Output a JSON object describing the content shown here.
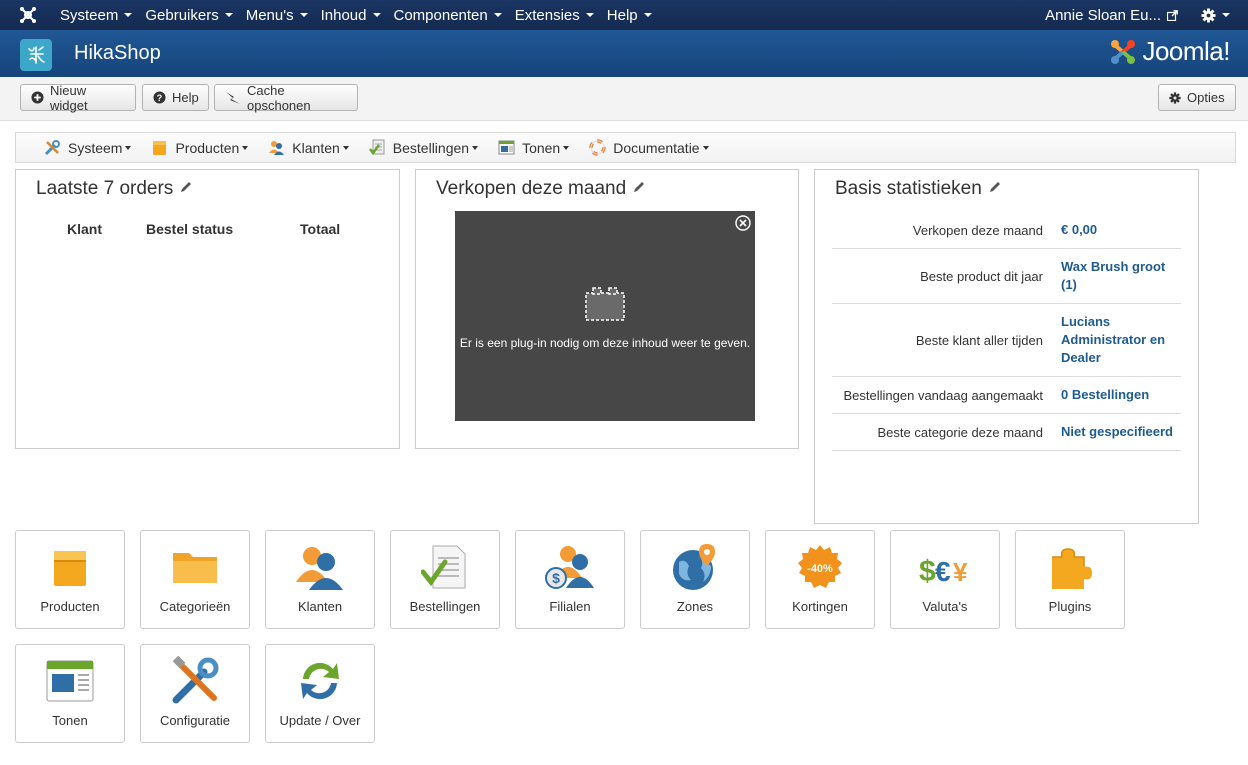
{
  "topnav": {
    "menu": [
      "Systeem",
      "Gebruikers",
      "Menu's",
      "Inhoud",
      "Componenten",
      "Extensies",
      "Help"
    ],
    "user": "Annie Sloan Eu..."
  },
  "header": {
    "title": "HikaShop",
    "brand": "Joomla!"
  },
  "toolbar": {
    "new_widget": "Nieuw widget",
    "help": "Help",
    "clear_cache": "Cache opschonen",
    "options": "Opties"
  },
  "submenu": [
    "Systeem",
    "Producten",
    "Klanten",
    "Bestellingen",
    "Tonen",
    "Documentatie"
  ],
  "orders": {
    "title": "Laatste 7 orders",
    "columns": [
      "Klant",
      "Bestel status",
      "Totaal"
    ]
  },
  "sales": {
    "title": "Verkopen deze maand",
    "plugin_message": "Er is een plug-in nodig om deze inhoud weer te geven."
  },
  "stats": {
    "title": "Basis statistieken",
    "rows": [
      {
        "label": "Verkopen deze maand",
        "value": "€ 0,00"
      },
      {
        "label": "Beste product dit jaar",
        "value": "Wax Brush groot (1)"
      },
      {
        "label": "Beste klant aller tijden",
        "value": "Lucians Administrator en Dealer"
      },
      {
        "label": "Bestellingen vandaag aangemaakt",
        "value": "0 Bestellingen"
      },
      {
        "label": "Beste categorie deze maand",
        "value": "Niet gespecifieerd"
      }
    ]
  },
  "tiles": [
    "Producten",
    "Categorieën",
    "Klanten",
    "Bestellingen",
    "Filialen",
    "Zones",
    "Kortingen",
    "Valuta's",
    "Plugins",
    "Tonen",
    "Configuratie",
    "Update / Over"
  ],
  "colors": {
    "topnav": "#172d53",
    "header": "#1a4a82",
    "link": "#1f5b8f"
  }
}
